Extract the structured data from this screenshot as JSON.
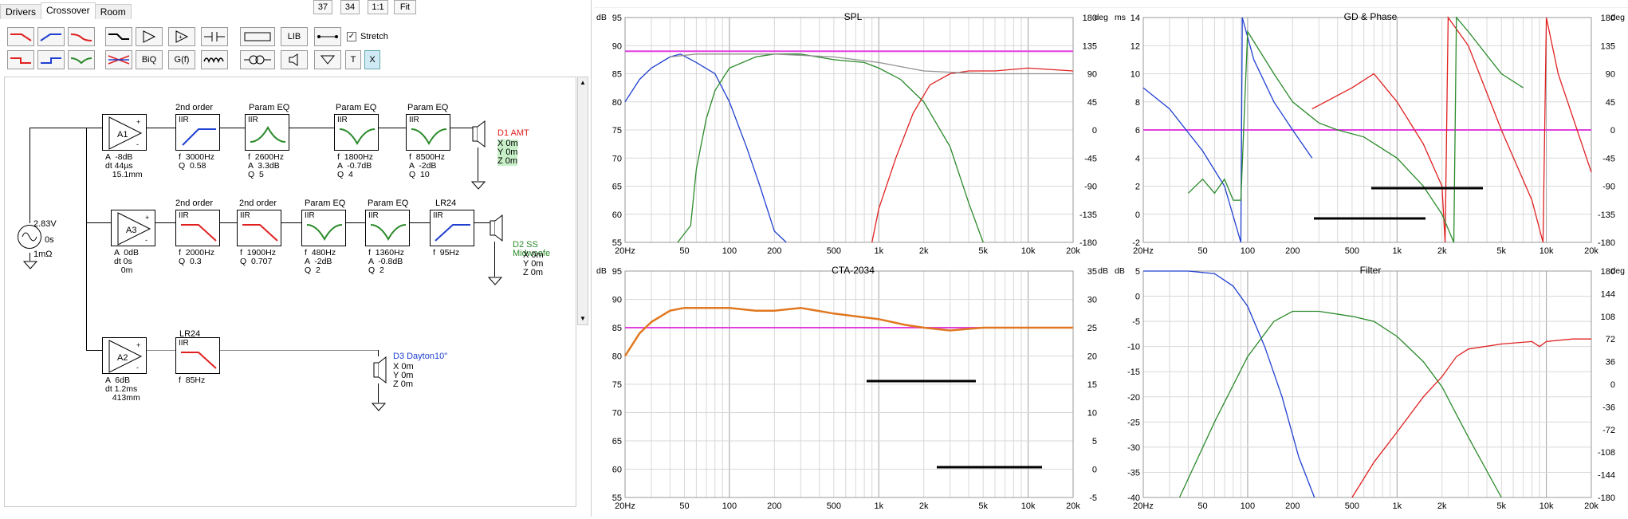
{
  "tabs": [
    {
      "label": "Drivers"
    },
    {
      "label": "Crossover"
    },
    {
      "label": "Room"
    }
  ],
  "top_buttons": {
    "b1": "37",
    "b2": "34",
    "b3": "1:1",
    "b4": "Fit"
  },
  "toolbar": {
    "stretch_label": "Stretch",
    "lib": "LIB",
    "biq": "BiQ",
    "gf": "G(f)",
    "t": "T",
    "x": "X"
  },
  "source": {
    "voltage": "2.83V",
    "delay": "0s",
    "resistance": "1mΩ"
  },
  "amps": [
    {
      "name": "A1",
      "lines": "A  -8dB\ndt 44µs\n   15.1mm"
    },
    {
      "name": "A3",
      "lines": "A  0dB\ndt 0s\n   0m"
    },
    {
      "name": "A2",
      "lines": "A  6dB\ndt 1.2ms\n   413mm"
    }
  ],
  "blocks": [
    {
      "head": "2nd order",
      "t": "IIR",
      "lines": "f  3000Hz\nQ  0.58"
    },
    {
      "head": "Param EQ",
      "t": "IIR",
      "lines": "f  2600Hz\nA  3.3dB\nQ  5"
    },
    {
      "head": "Param EQ",
      "t": "IIR",
      "lines": "f  1800Hz\nA  -0.7dB\nQ  4"
    },
    {
      "head": "Param EQ",
      "t": "IIR",
      "lines": "f  8500Hz\nA  -2dB\nQ  10"
    },
    {
      "head": "2nd order",
      "t": "IIR",
      "lines": "f  2000Hz\nQ  0.3"
    },
    {
      "head": "2nd order",
      "t": "IIR",
      "lines": "f  1900Hz\nQ  0.707"
    },
    {
      "head": "Param EQ",
      "t": "IIR",
      "lines": "f  480Hz\nA  -2dB\nQ  2"
    },
    {
      "head": "Param EQ",
      "t": "IIR",
      "lines": "f  1360Hz\nA  -0.8dB\nQ  2"
    },
    {
      "head": "LR24",
      "t": "IIR",
      "lines": "f  95Hz"
    },
    {
      "head": "LR24",
      "t": "IIR",
      "lines": "f  85Hz"
    }
  ],
  "drivers": [
    {
      "name": "D1 AMT",
      "x": "X 0m",
      "y": "Y 0m",
      "z": "Z 0m",
      "color": "#e02020"
    },
    {
      "name": "D2 SS Midwoofe",
      "x": "X 0m",
      "y": "Y 0m",
      "z": "Z 0m",
      "color": "#2a8a2a"
    },
    {
      "name": "D3 Dayton10\"",
      "x": "X 0m",
      "y": "Y 0m",
      "z": "Z 0m",
      "color": "#2040d0"
    }
  ],
  "charts": [
    {
      "title": "SPL",
      "unit_left": "dB",
      "unit_right": "deg",
      "left_ticks": [
        "95",
        "90",
        "85",
        "80",
        "75",
        "70",
        "65",
        "60",
        "55"
      ],
      "right_ticks": [
        "180",
        "135",
        "90",
        "45",
        "0",
        "-45",
        "-90",
        "-135",
        "-180"
      ]
    },
    {
      "title": "GD & Phase",
      "unit_left": "ms",
      "unit_right": "deg",
      "left_ticks": [
        "14",
        "12",
        "10",
        "8",
        "6",
        "4",
        "2",
        "0",
        "-2"
      ],
      "right_ticks": [
        "180",
        "135",
        "90",
        "45",
        "0",
        "-45",
        "-90",
        "-135",
        "-180"
      ]
    },
    {
      "title": "CTA-2034",
      "unit_left": "dB",
      "unit_right": "dB",
      "left_ticks": [
        "95",
        "90",
        "85",
        "80",
        "75",
        "70",
        "65",
        "60",
        "55"
      ],
      "right_ticks": [
        "35",
        "30",
        "25",
        "20",
        "15",
        "10",
        "5",
        "0",
        "-5"
      ]
    },
    {
      "title": "Filter",
      "unit_left": "dB",
      "unit_right": "deg",
      "left_ticks": [
        "5",
        "0",
        "-5",
        "-10",
        "-15",
        "-20",
        "-25",
        "-30",
        "-35",
        "-40"
      ],
      "right_ticks": [
        "180",
        "144",
        "108",
        "72",
        "36",
        "0",
        "-36",
        "-72",
        "-108",
        "-144",
        "-180"
      ]
    }
  ],
  "x_ticks": [
    {
      "f": 20,
      "l": "20Hz"
    },
    {
      "f": 50,
      "l": "50"
    },
    {
      "f": 100,
      "l": "100"
    },
    {
      "f": 200,
      "l": "200"
    },
    {
      "f": 500,
      "l": "500"
    },
    {
      "f": 1000,
      "l": "1k"
    },
    {
      "f": 2000,
      "l": "2k"
    },
    {
      "f": 5000,
      "l": "5k"
    },
    {
      "f": 10000,
      "l": "10k"
    },
    {
      "f": 20000,
      "l": "20k"
    }
  ],
  "colors": {
    "blue": "#2040d0",
    "green": "#2a8a2a",
    "red": "#e02020",
    "gray": "#909090",
    "orange": "#e07820",
    "magenta": "#e040e0",
    "grid": "#d8d8d8",
    "grid_major": "#a0a0a0"
  },
  "chart_data": [
    {
      "type": "line",
      "title": "SPL",
      "xlabel": "",
      "ylabel": "dB",
      "x_scale": "log",
      "xlim": [
        20,
        20000
      ],
      "ylim": [
        55,
        95
      ],
      "series": [
        {
          "name": "",
          "color": "blue",
          "x": [
            20,
            25,
            30,
            40,
            47,
            60,
            80,
            100,
            130,
            160,
            200,
            240
          ],
          "values": [
            80,
            84,
            86,
            88,
            88.5,
            87,
            85,
            80,
            72,
            65,
            57,
            55
          ]
        },
        {
          "name": "",
          "color": "green",
          "x": [
            45,
            55,
            60,
            70,
            80,
            100,
            150,
            200,
            300,
            500,
            800,
            1000,
            1400,
            2000,
            3000,
            4000,
            5000
          ],
          "values": [
            55,
            58,
            68,
            77,
            82,
            86,
            88,
            88.5,
            88.5,
            87.5,
            87,
            86,
            84,
            80,
            72,
            62,
            55
          ]
        },
        {
          "name": "",
          "color": "red",
          "x": [
            900,
            1000,
            1300,
            1700,
            2200,
            3000,
            4000,
            6000,
            10000,
            20000
          ],
          "values": [
            55,
            61,
            70,
            78,
            83,
            85,
            85.5,
            85.5,
            86,
            85.5
          ]
        },
        {
          "name": "",
          "color": "gray",
          "x": [
            40,
            60,
            100,
            200,
            500,
            1000,
            2000,
            5000,
            10000,
            20000
          ],
          "values": [
            88,
            88.5,
            88.5,
            88.5,
            88,
            87,
            85.5,
            85,
            85,
            85
          ]
        }
      ],
      "hlines": [
        {
          "y": 89,
          "color": "magenta"
        }
      ]
    },
    {
      "type": "line",
      "title": "GD & Phase",
      "xlabel": "",
      "ylabel": "ms",
      "x_scale": "log",
      "xlim": [
        20,
        20000
      ],
      "ylim": [
        -2,
        14
      ],
      "series": [
        {
          "name": "",
          "color": "blue",
          "x": [
            20,
            30,
            50,
            70,
            90,
            92,
            110,
            150,
            200,
            270
          ],
          "values": [
            9,
            7.5,
            4.5,
            2,
            -2,
            14,
            11,
            8,
            6,
            4
          ]
        },
        {
          "name": "",
          "color": "red",
          "x": [
            270,
            500,
            700,
            1000,
            1500,
            2000,
            2100,
            2200,
            3000,
            5000,
            8000,
            9500,
            10000,
            12000,
            20000
          ],
          "values": [
            7.5,
            9,
            10,
            8,
            5,
            2,
            -2,
            14,
            12,
            6,
            1,
            -2,
            14,
            10,
            3
          ]
        },
        {
          "name": "",
          "color": "green",
          "x": [
            40,
            50,
            60,
            70,
            80,
            90,
            100,
            150,
            200,
            300,
            400,
            600,
            1000,
            1500,
            2000,
            2400,
            2500,
            3000,
            5000,
            7000
          ],
          "values": [
            1.5,
            2.5,
            1.5,
            2.5,
            1,
            1,
            13,
            10,
            8,
            6.5,
            6,
            5.5,
            4,
            2,
            0,
            -2,
            14,
            13,
            10,
            9
          ]
        }
      ],
      "hlines": [
        {
          "y": 6,
          "color": "magenta"
        }
      ]
    },
    {
      "type": "line",
      "title": "CTA-2034",
      "xlabel": "",
      "ylabel": "dB",
      "x_scale": "log",
      "xlim": [
        20,
        20000
      ],
      "ylim": [
        55,
        95
      ],
      "series": [
        {
          "name": "",
          "color": "orange",
          "x": [
            20,
            25,
            30,
            40,
            50,
            70,
            100,
            150,
            200,
            300,
            500,
            700,
            1000,
            1500,
            2000,
            3000,
            5000,
            10000,
            20000
          ],
          "values": [
            80,
            84,
            86,
            88,
            88.5,
            88.5,
            88.5,
            88,
            88,
            88.5,
            87.5,
            87,
            86.5,
            85.5,
            85,
            84.5,
            85,
            85,
            85
          ]
        }
      ],
      "hlines": [
        {
          "y": 85,
          "color": "magenta"
        }
      ]
    },
    {
      "type": "line",
      "title": "Filter",
      "xlabel": "",
      "ylabel": "dB",
      "x_scale": "log",
      "xlim": [
        20,
        20000
      ],
      "ylim": [
        -40,
        5
      ],
      "series": [
        {
          "name": "",
          "color": "blue",
          "x": [
            20,
            40,
            60,
            80,
            100,
            130,
            170,
            220,
            280
          ],
          "values": [
            6,
            5.8,
            4.5,
            2,
            -2,
            -10,
            -20,
            -32,
            -40
          ]
        },
        {
          "name": "",
          "color": "green",
          "x": [
            35,
            60,
            100,
            150,
            200,
            300,
            500,
            700,
            1000,
            1500,
            2000,
            3000,
            5000
          ],
          "values": [
            -40,
            -25,
            -12,
            -5,
            -3,
            -3,
            -4,
            -5,
            -8,
            -13,
            -18,
            -28,
            -40
          ]
        },
        {
          "name": "",
          "color": "red",
          "x": [
            500,
            700,
            1000,
            1500,
            2000,
            2500,
            3000,
            5000,
            8000,
            9000,
            10000,
            15000,
            20000
          ],
          "values": [
            -40,
            -33,
            -27,
            -20,
            -16,
            -12,
            -10.5,
            -9.5,
            -9,
            -10,
            -9,
            -8.5,
            -8.5
          ]
        }
      ]
    }
  ]
}
